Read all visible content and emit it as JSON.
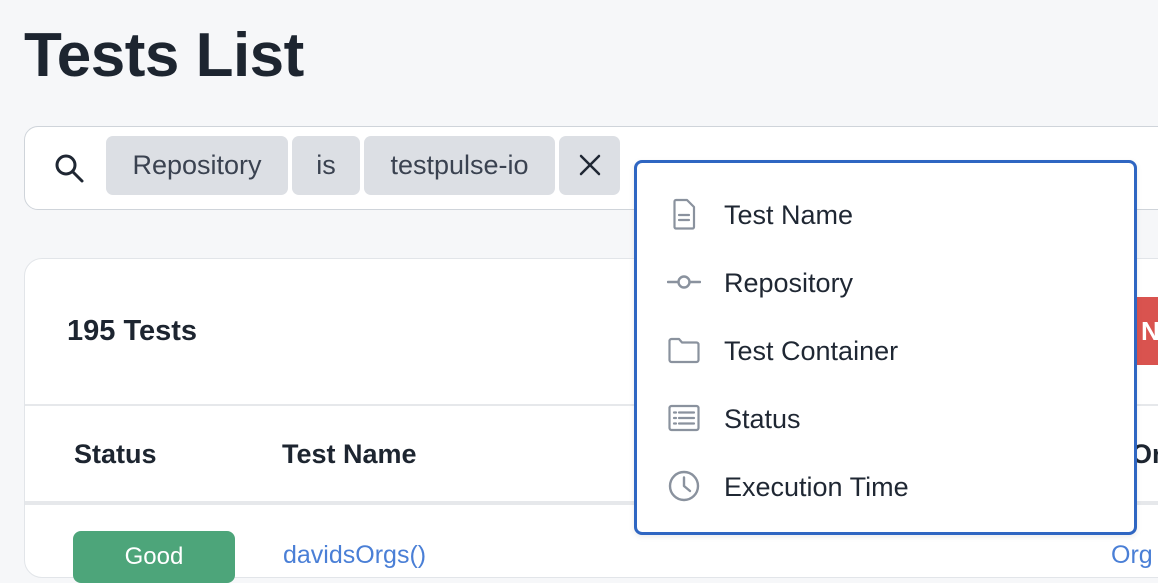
{
  "page": {
    "title": "Tests List"
  },
  "search": {
    "chips": [
      "Repository",
      "is",
      "testpulse-io"
    ]
  },
  "dropdown": {
    "items": [
      {
        "label": "Test Name",
        "icon": "file-icon"
      },
      {
        "label": "Repository",
        "icon": "commit-icon"
      },
      {
        "label": "Test Container",
        "icon": "folder-icon"
      },
      {
        "label": "Status",
        "icon": "list-icon"
      },
      {
        "label": "Execution Time",
        "icon": "clock-icon"
      }
    ]
  },
  "card": {
    "count_label": "195 Tests",
    "action_button_partial": "N",
    "columns": [
      "Status",
      "Test Name",
      "Or"
    ],
    "first_row": {
      "status": "Good",
      "test_name": "davidsOrgs()",
      "origin_partial": "Org"
    }
  },
  "colors": {
    "accent_border": "#2f66c2",
    "danger": "#d9534f",
    "success": "#4da57a",
    "link": "#4a7fd6"
  }
}
